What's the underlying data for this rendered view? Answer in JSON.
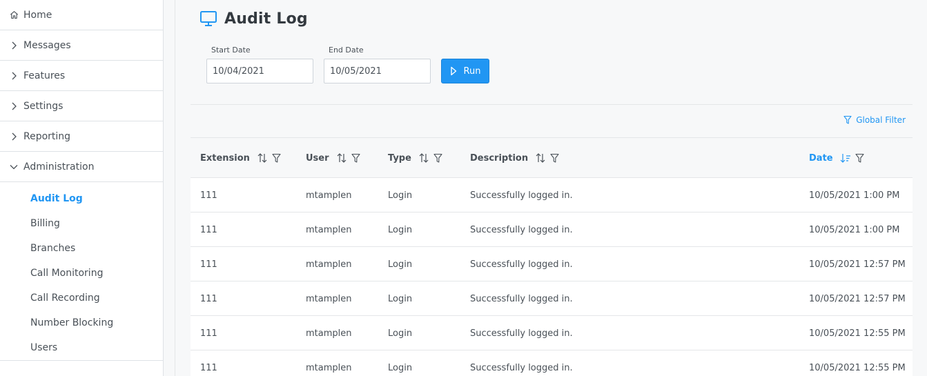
{
  "sidebar": {
    "items": [
      {
        "label": "Home",
        "icon": "home-icon"
      },
      {
        "label": "Messages",
        "icon": "chevron-right-icon"
      },
      {
        "label": "Features",
        "icon": "chevron-right-icon"
      },
      {
        "label": "Settings",
        "icon": "chevron-right-icon"
      },
      {
        "label": "Reporting",
        "icon": "chevron-right-icon"
      },
      {
        "label": "Administration",
        "icon": "chevron-down-icon"
      }
    ],
    "sub_items": [
      {
        "label": "Audit Log",
        "active": true
      },
      {
        "label": "Billing"
      },
      {
        "label": "Branches"
      },
      {
        "label": "Call Monitoring"
      },
      {
        "label": "Call Recording"
      },
      {
        "label": "Number Blocking"
      },
      {
        "label": "Users"
      }
    ]
  },
  "page": {
    "title": "Audit Log",
    "icon": "monitor-icon"
  },
  "filters": {
    "start_label": "Start Date",
    "start_value": "10/04/2021",
    "end_label": "End Date",
    "end_value": "10/05/2021",
    "run_label": "Run"
  },
  "table": {
    "global_filter_label": "Global Filter",
    "columns": [
      {
        "label": "Extension"
      },
      {
        "label": "User"
      },
      {
        "label": "Type"
      },
      {
        "label": "Description"
      },
      {
        "label": "Date",
        "sorted": "descending"
      }
    ],
    "rows": [
      [
        "111",
        "mtamplen",
        "Login",
        "Successfully logged in.",
        "10/05/2021 1:00 PM"
      ],
      [
        "111",
        "mtamplen",
        "Login",
        "Successfully logged in.",
        "10/05/2021 1:00 PM"
      ],
      [
        "111",
        "mtamplen",
        "Login",
        "Successfully logged in.",
        "10/05/2021 12:57 PM"
      ],
      [
        "111",
        "mtamplen",
        "Login",
        "Successfully logged in.",
        "10/05/2021 12:57 PM"
      ],
      [
        "111",
        "mtamplen",
        "Login",
        "Successfully logged in.",
        "10/05/2021 12:55 PM"
      ],
      [
        "111",
        "mtamplen",
        "Login",
        "Successfully logged in.",
        "10/05/2021 12:55 PM"
      ]
    ]
  },
  "colors": {
    "accent": "#2196f3",
    "text": "#495057",
    "border": "#dee2e6"
  }
}
